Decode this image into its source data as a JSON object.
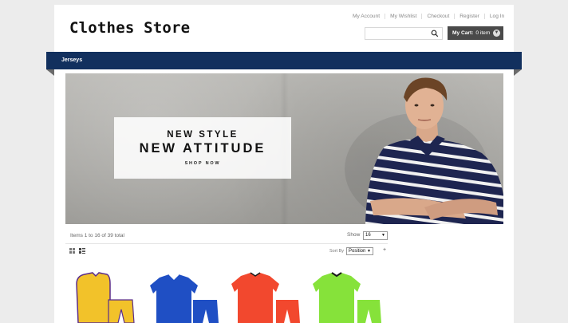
{
  "header": {
    "logo": "Clothes Store",
    "links": [
      "My Account",
      "My Wishlist",
      "Checkout",
      "Register",
      "Log In"
    ],
    "search": {
      "placeholder": ""
    },
    "cart": {
      "label": "My Cart:",
      "count": "0 item"
    }
  },
  "nav": {
    "items": [
      "Jerseys"
    ]
  },
  "banner": {
    "line1": "NEW STYLE",
    "line2": "NEW ATTITUDE",
    "cta": "SHOP NOW"
  },
  "toolbar": {
    "count_text": "Items 1 to 16 of 39 total",
    "show_label": "Show",
    "show_value": "16",
    "sort_label": "Sort By",
    "sort_value": "Position",
    "direction": "+"
  },
  "colors": {
    "nav": "#12305e",
    "cart": "#4a4a4a",
    "products": [
      "#f2c22a",
      "#1f4fc4",
      "#f2482e",
      "#86e23a"
    ]
  },
  "products": [
    {
      "name": "yellow-jersey-kit",
      "shirt": "#f2c22a",
      "trim": "#5a2d8c",
      "shorts": "#f2c22a"
    },
    {
      "name": "blue-jersey-kit",
      "shirt": "#1f4fc4",
      "trim": "#ffffff",
      "shorts": "#1f4fc4"
    },
    {
      "name": "red-jersey-kit",
      "shirt": "#f2482e",
      "trim": "#1a1a1a",
      "shorts": "#f2482e"
    },
    {
      "name": "green-jersey-kit",
      "shirt": "#86e23a",
      "trim": "#1a1a1a",
      "shorts": "#86e23a"
    }
  ]
}
